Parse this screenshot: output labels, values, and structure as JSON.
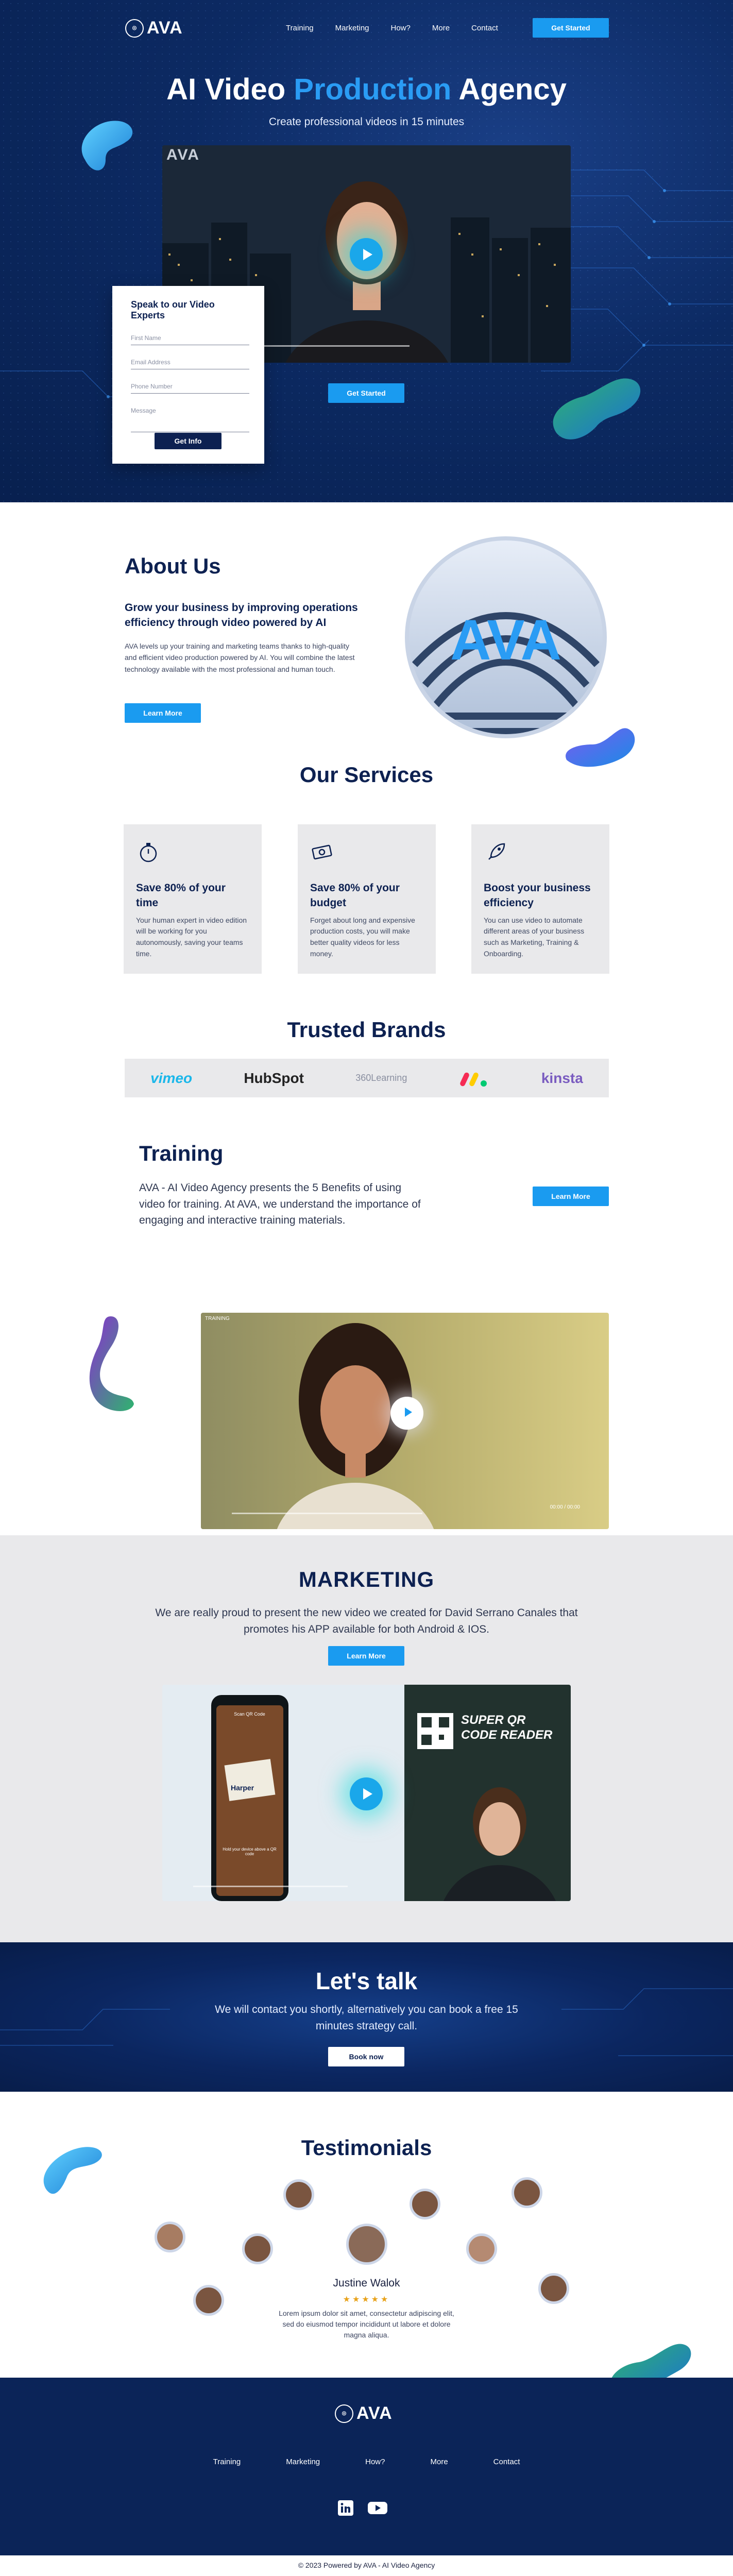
{
  "colors": {
    "navy": "#0b2458",
    "accent": "#1a9bf0",
    "light_gray": "#e9e9eb"
  },
  "nav": {
    "logo": "AVA",
    "links": [
      "Training",
      "Marketing",
      "How?",
      "More",
      "Contact"
    ],
    "cta": "Get Started"
  },
  "hero": {
    "title_part1": "AI Video ",
    "title_accent": "Production",
    "title_part2": " Agency",
    "subtitle": "Create professional videos in 15 minutes",
    "video_logo": "AVA",
    "cta": "Get Started"
  },
  "form": {
    "title": "Speak to our Video Experts",
    "fields": [
      "First Name",
      "Email Address",
      "Phone Number",
      "Message"
    ],
    "submit": "Get Info"
  },
  "about": {
    "title": "About Us",
    "lead": "Grow your business by improving operations efficiency through video powered by AI",
    "body": "AVA levels up your training and marketing teams thanks to high-quality and efficient video production powered by AI. You will combine the latest technology available with the most professional and human touch.",
    "cta": "Learn More",
    "emblem": "AVA"
  },
  "services": {
    "title": "Our Services",
    "cards": [
      {
        "icon": "stopwatch-icon",
        "title": "Save 80% of your time",
        "body": "Your human expert in video edition will be working for you autonomously, saving your teams time."
      },
      {
        "icon": "money-icon",
        "title": "Save 80% of your budget",
        "body": "Forget about long and expensive production costs, you will make better quality videos for less money."
      },
      {
        "icon": "rocket-icon",
        "title": "Boost your business efficiency",
        "body": "You can use video to automate different areas of your business such as Marketing, Training & Onboarding."
      }
    ]
  },
  "brands": {
    "title": "Trusted Brands",
    "items": [
      "vimeo",
      "HubSpot",
      "360Learning",
      "",
      "kinsta"
    ]
  },
  "training": {
    "title": "Training",
    "body": "AVA - AI Video Agency presents the 5 Benefits of using video for training. At AVA, we understand the importance of engaging and interactive training materials.",
    "cta": "Learn More",
    "video_tag": "TRAINING",
    "video_time": "00:00 / 00:00"
  },
  "marketing": {
    "title": "MARKETING",
    "body": "We are really proud to present the new video we created for David Serrano Canales that promotes his APP available for both Android & IOS.",
    "cta": "Learn More",
    "video_title": "SUPER QR CODE READER",
    "phone_label": "Scan QR Code",
    "phone_hint": "Hold your device above a QR code",
    "ticket_brand": "Harper"
  },
  "talk": {
    "title": "Let's talk",
    "body": "We will contact you shortly, alternatively you can book a free 15 minutes strategy call.",
    "cta": "Book now"
  },
  "testimonials": {
    "title": "Testimonials",
    "name": "Justine Walok",
    "stars": "★★★★★",
    "quote": "Lorem ipsum dolor sit amet, consectetur adipiscing elit, sed do eiusmod tempor incididunt ut labore et dolore magna aliqua."
  },
  "footer": {
    "logo": "AVA",
    "links": [
      "Training",
      "Marketing",
      "How?",
      "More",
      "Contact"
    ],
    "copyright": "© 2023 Powered by AVA - AI Video Agency"
  }
}
